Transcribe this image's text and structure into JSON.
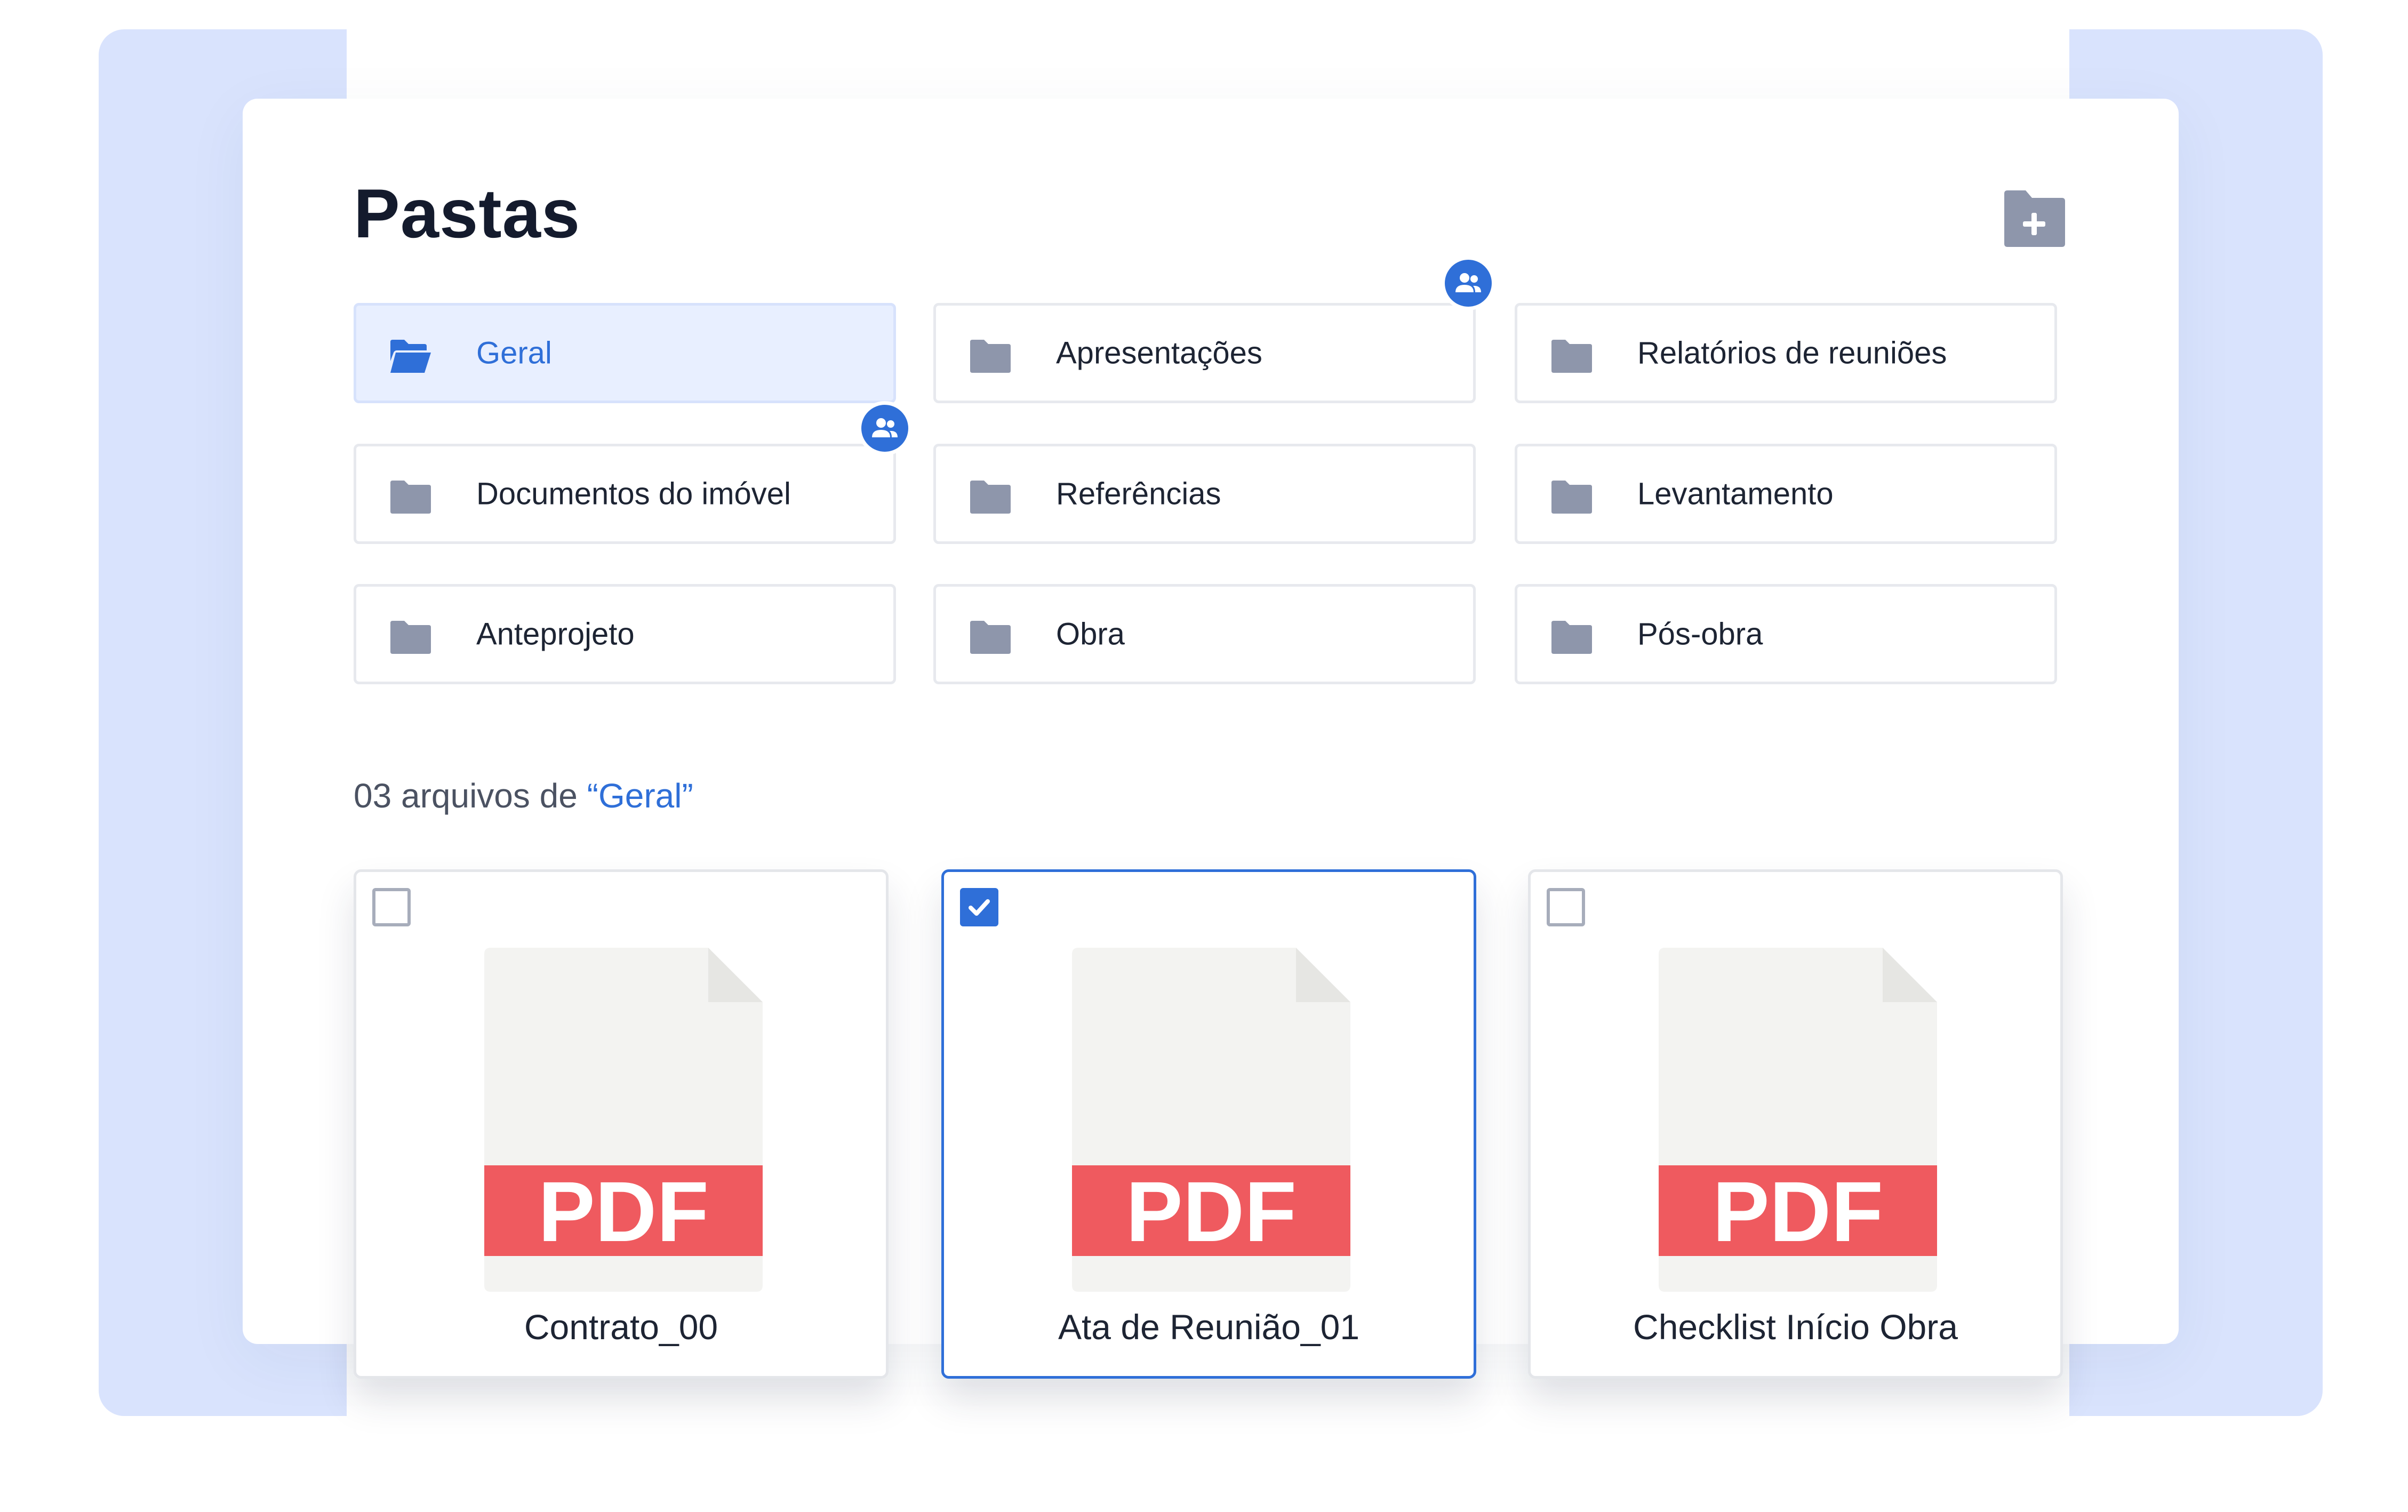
{
  "page": {
    "title": "Pastas",
    "new_folder_icon": "folder-plus-icon"
  },
  "folders": [
    {
      "label": "Geral",
      "active": true,
      "icon": "folder-open-icon",
      "shared": false
    },
    {
      "label": "Apresentações",
      "active": false,
      "icon": "folder-icon",
      "shared": true
    },
    {
      "label": "Relatórios de reuniões",
      "active": false,
      "icon": "folder-icon",
      "shared": false
    },
    {
      "label": "Documentos do imóvel",
      "active": false,
      "icon": "folder-icon",
      "shared": false
    },
    {
      "label": "Referências",
      "active": false,
      "icon": "folder-icon",
      "shared": false
    },
    {
      "label": "Levantamento",
      "active": false,
      "icon": "folder-icon",
      "shared": false
    },
    {
      "label": "Anteprojeto",
      "active": false,
      "icon": "folder-icon",
      "shared": false
    },
    {
      "label": "Obra",
      "active": false,
      "icon": "folder-icon",
      "shared": false
    },
    {
      "label": "Pós-obra",
      "active": false,
      "icon": "folder-icon",
      "shared": false
    }
  ],
  "files_header": {
    "prefix": "03 arquivos de ",
    "folder_ref": "“Geral”"
  },
  "files": [
    {
      "name": "Contrato_00",
      "type_label": "PDF",
      "selected": false
    },
    {
      "name": "Ata de Reunião_01",
      "type_label": "PDF",
      "selected": true
    },
    {
      "name": "Checklist Início Obra",
      "type_label": "PDF",
      "selected": false
    }
  ],
  "colors": {
    "accent": "#2f6fd8",
    "pdf_band": "#ef5a5f",
    "folder_icon": "#8e96ab",
    "background_panel": "#d9e3fd"
  }
}
